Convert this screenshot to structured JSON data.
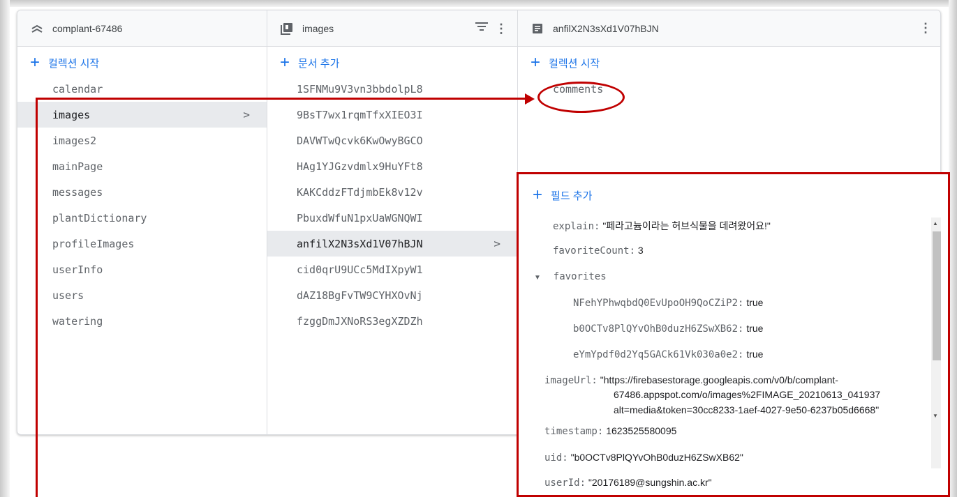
{
  "projects_panel": {
    "title": "complant-67486",
    "add_label": "컬렉션 시작",
    "items": [
      {
        "label": "calendar"
      },
      {
        "label": "images",
        "selected": true
      },
      {
        "label": "images2"
      },
      {
        "label": "mainPage"
      },
      {
        "label": "messages"
      },
      {
        "label": "plantDictionary"
      },
      {
        "label": "profileImages"
      },
      {
        "label": "userInfo"
      },
      {
        "label": "users"
      },
      {
        "label": "watering"
      }
    ]
  },
  "collection_panel": {
    "title": "images",
    "add_label": "문서 추가",
    "items": [
      {
        "label": "1SFNMu9V3vn3bbdolpL8"
      },
      {
        "label": "9BsT7wx1rqmTfxXIEO3I"
      },
      {
        "label": "DAVWTwQcvk6KwOwyBGCO"
      },
      {
        "label": "HAg1YJGzvdmlx9HuYFt8"
      },
      {
        "label": "KAKCddzFTdjmbEk8v12v"
      },
      {
        "label": "PbuxdWfuN1pxUaWGNQWI"
      },
      {
        "label": "anfilX2N3sXd1V07hBJN",
        "selected": true
      },
      {
        "label": "cid0qrU9UCc5MdIXpyW1"
      },
      {
        "label": "dAZ18BgFvTW9CYHXOvNj"
      },
      {
        "label": "fzggDmJXNoRS3egXZDZh"
      }
    ]
  },
  "document_panel": {
    "title": "anfilX2N3sXd1V07hBJN",
    "add_collection_label": "컬렉션 시작",
    "subcollection": "comments",
    "add_field_label": "필드 추가",
    "fields": {
      "explain": {
        "key": "explain:",
        "value": "\"페라고늄이라는 허브식물을 데려왔어요!\""
      },
      "favoriteCount": {
        "key": "favoriteCount:",
        "value": "3"
      },
      "favorites": {
        "key": "favorites"
      },
      "fav1": {
        "key": "NFehYPhwqbdQ0EvUpoOH9QoCZiP2:",
        "value": "true"
      },
      "fav2": {
        "key": "b0OCTv8PlQYvOhB0duzH6ZSwXB62:",
        "value": "true"
      },
      "fav3": {
        "key": "eYmYpdf0d2Yq5GACk61Vk030a0e2:",
        "value": "true"
      },
      "imageUrl": {
        "key": "imageUrl:",
        "line1": "\"https://firebasestorage.googleapis.com/v0/b/complant-",
        "line2": "67486.appspot.com/o/images%2FIMAGE_20210613_041937",
        "line3": "alt=media&token=30cc8233-1aef-4027-9e50-6237b05d6668\""
      },
      "timestamp": {
        "key": "timestamp:",
        "value": "1623525580095"
      },
      "uid": {
        "key": "uid:",
        "value": "\"b0OCTv8PlQYvOhB0duzH6ZSwXB62\""
      },
      "userId": {
        "key": "userId:",
        "value": "\"20176189@sungshin.ac.kr\""
      }
    }
  },
  "colors": {
    "accent": "#1a73e8",
    "annotation": "#c00000",
    "selected_bg": "#e8eaed"
  }
}
